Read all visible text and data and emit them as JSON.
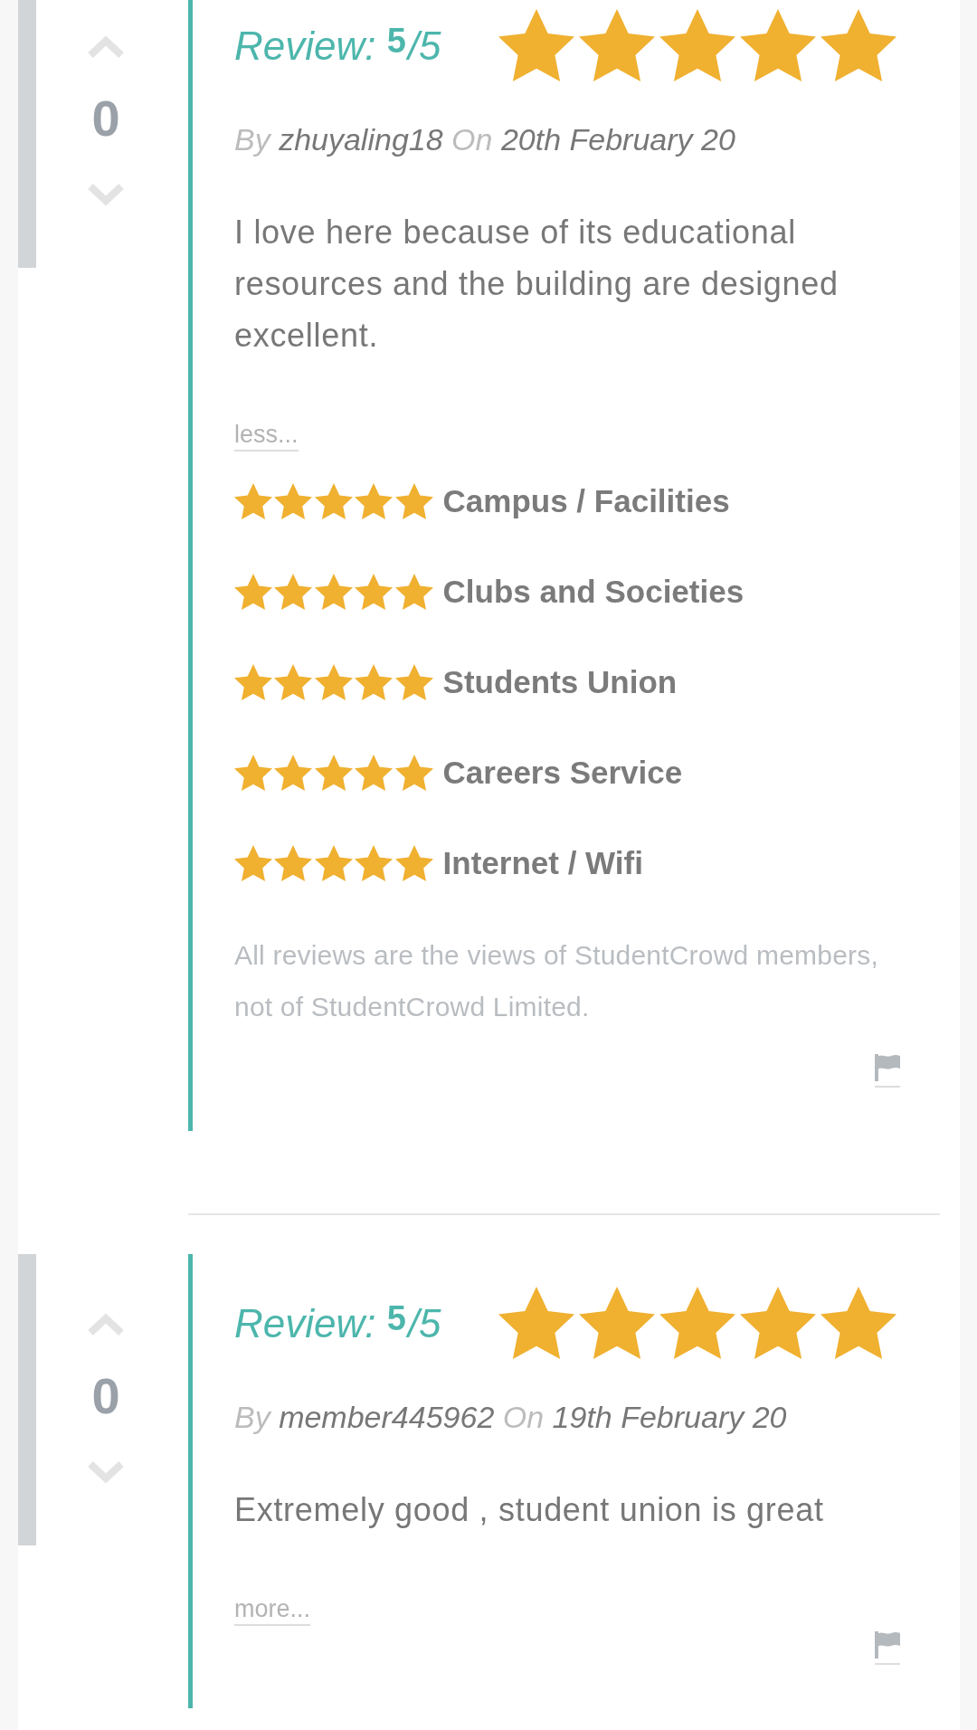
{
  "reviews": [
    {
      "votes": "0",
      "rating_label": "Review:",
      "rating_value": "5",
      "rating_scale": "/5",
      "stars": 5,
      "by_label": "By",
      "author": "zhuyaling18",
      "on_label": "On",
      "date": "20th February 20",
      "text": "I love here because of its educational resources and the building are designed excellent.",
      "toggle_link": "less...",
      "categories": [
        {
          "label": "Campus / Facilities",
          "stars": 5
        },
        {
          "label": "Clubs and Societies",
          "stars": 5
        },
        {
          "label": "Students Union",
          "stars": 5
        },
        {
          "label": "Careers Service",
          "stars": 5
        },
        {
          "label": "Internet / Wifi",
          "stars": 5
        }
      ],
      "disclaimer": "All reviews are the views of StudentCrowd members, not of StudentCrowd Limited."
    },
    {
      "votes": "0",
      "rating_label": "Review:",
      "rating_value": "5",
      "rating_scale": "/5",
      "stars": 5,
      "by_label": "By",
      "author": "member445962",
      "on_label": "On",
      "date": "19th February 20",
      "text": "Extremely good , student union is great",
      "toggle_link": "more..."
    }
  ]
}
